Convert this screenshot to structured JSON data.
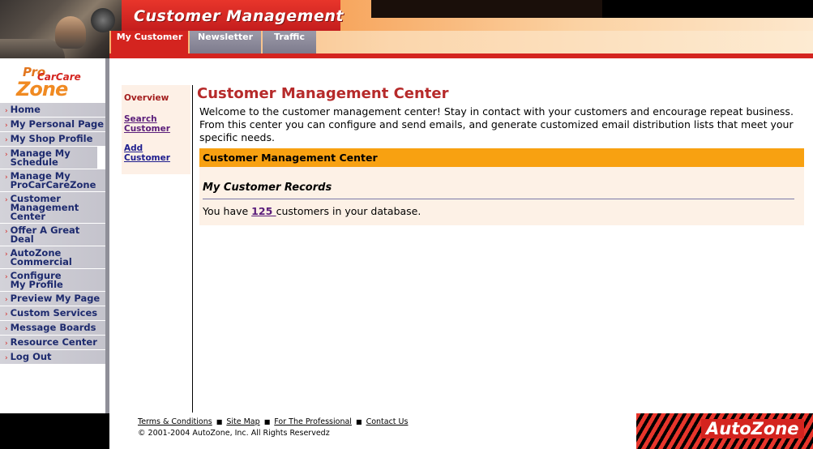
{
  "header": {
    "title": "Customer Management",
    "tabs": [
      {
        "label": "My Customer",
        "active": true
      },
      {
        "label": "Newsletter",
        "active": false
      },
      {
        "label": "Traffic",
        "active": false
      }
    ]
  },
  "logo": {
    "pro": "Pro",
    "carcare": "CarCare",
    "zone": "Zone"
  },
  "sidebar": {
    "arrow": "›",
    "items": [
      {
        "label": "Home"
      },
      {
        "label": "My Personal Page"
      },
      {
        "label": "My Shop Profile"
      },
      {
        "label": "Manage My Schedule"
      },
      {
        "label": "Manage My ProCarCareZone"
      },
      {
        "label": "Customer Management Center"
      },
      {
        "label": "Offer A Great Deal"
      },
      {
        "label": "AutoZone Commercial"
      },
      {
        "label": "Configure My Profile"
      },
      {
        "label": "Preview My Page"
      },
      {
        "label": "Custom Services"
      },
      {
        "label": "Message Boards"
      },
      {
        "label": "Resource Center"
      },
      {
        "label": "Log Out"
      }
    ]
  },
  "subnav": {
    "overview": "Overview",
    "search_customer": "Search Customer",
    "add_customer": "Add Customer"
  },
  "main": {
    "title": "Customer Management Center",
    "welcome": "Welcome to the customer management center! Stay in contact with your customers and encourage repeat business. From this center you can configure and send emails, and generate customized email distribution lists that meet your specific needs.",
    "section_title": "Customer Management Center",
    "records_heading": "My Customer Records",
    "records_prefix": "You have ",
    "customer_count": "125 ",
    "records_suffix": "customers in your database."
  },
  "footer": {
    "links": [
      "Terms & Conditions",
      "Site Map",
      "For The Professional",
      "Contact Us"
    ],
    "separator": "■",
    "copyright": "© 2001-2004 AutoZone, Inc. All Rights Reservedz",
    "brand": "AutoZone"
  },
  "colors": {
    "accent_red": "#d4241f",
    "orange": "#f8a111",
    "nav_text": "#1d2a6e"
  }
}
